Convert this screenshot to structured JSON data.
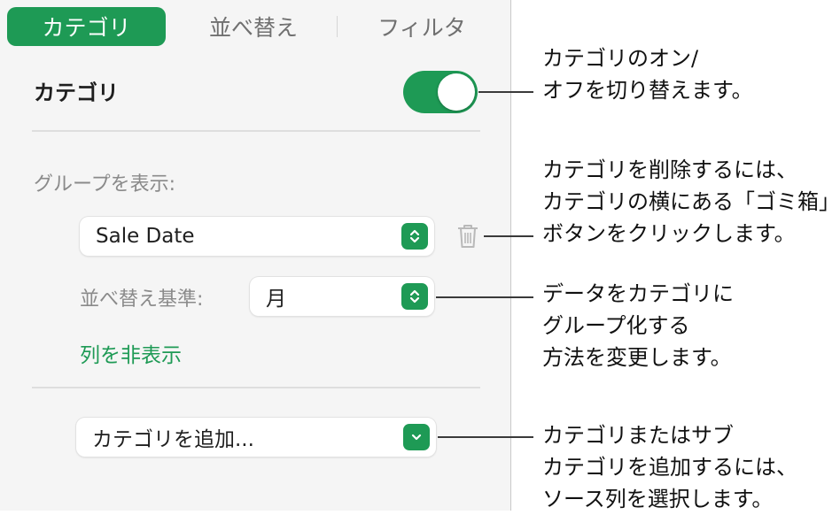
{
  "tabs": {
    "category": "カテゴリ",
    "sort": "並べ替え",
    "filter": "フィルタ"
  },
  "category_section": {
    "title": "カテゴリ",
    "toggle_on": true
  },
  "group": {
    "label": "グループを表示:",
    "selected": "Sale Date",
    "sort_label": "並べ替え基準:",
    "sort_value": "月",
    "hide_link": "列を非表示"
  },
  "add": {
    "label": "カテゴリを追加..."
  },
  "callouts": {
    "c1": [
      "カテゴリのオン/",
      "オフを切り替えます。"
    ],
    "c2": [
      "カテゴリを削除するには、",
      "カテゴリの横にある「ゴミ箱」",
      "ボタンをクリックします。"
    ],
    "c3": [
      "データをカテゴリに",
      "グループ化する",
      "方法を変更します。"
    ],
    "c4": [
      "カテゴリまたはサブ",
      "カテゴリを追加するには、",
      "ソース列を選択します。"
    ]
  },
  "colors": {
    "accent": "#1e9a55",
    "panel_bg": "#f5f5f5",
    "muted_text": "#8a8a8a"
  }
}
